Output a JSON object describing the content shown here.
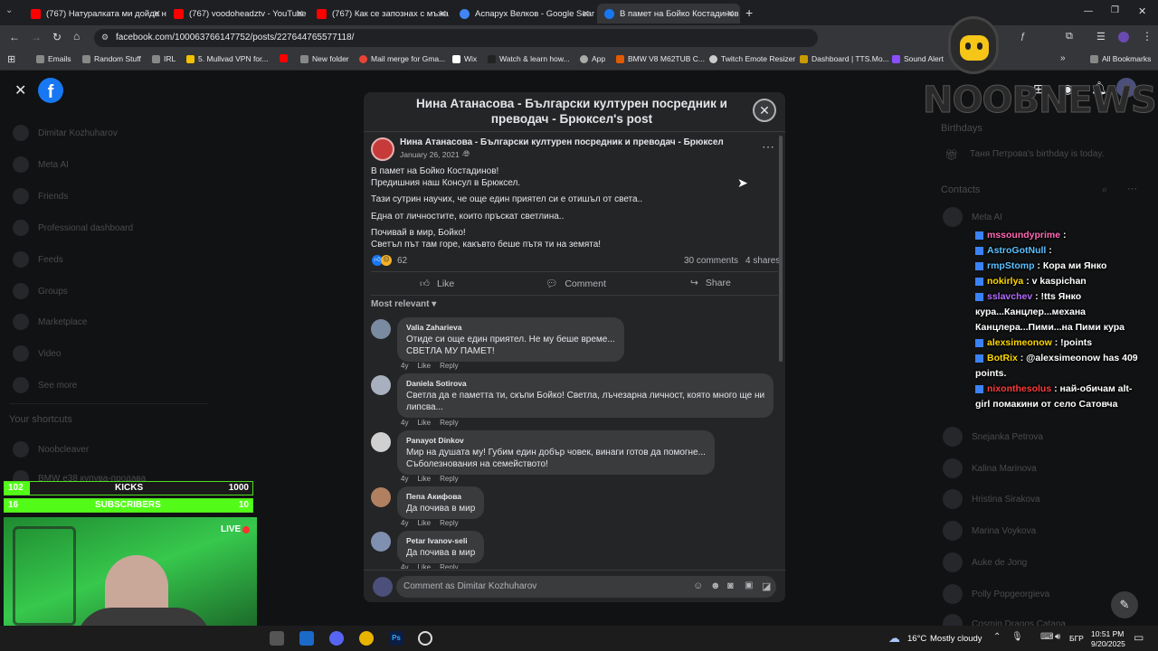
{
  "browser": {
    "tabs": [
      {
        "title": "(767) Натуралката ми дойде н",
        "color": "#ff0000"
      },
      {
        "title": "(767) voodoheadztv - YouTube",
        "color": "#ff0000"
      },
      {
        "title": "(767) Как се запознах с мъжа",
        "color": "#ff0000"
      },
      {
        "title": "Аспарух Велков - Google Sear",
        "color": "#4285f4"
      },
      {
        "title": "В памет на Бойко Костадинов",
        "color": "#1877f2"
      }
    ],
    "url": "facebook.com/100063766147752/posts/227644765577118/",
    "bookmarks": [
      "Emails",
      "Random Stuff",
      "IRL",
      "5. Mullvad VPN for...",
      "New folder",
      "Mail merge for Gma...",
      "Wix",
      "Watch & learn how...",
      "App",
      "BMW V8 M62TUB C...",
      "Twitch Emote Resizer",
      "Dashboard | TTS.Mo...",
      "Sound Alert"
    ],
    "all_bookmarks": "All Bookmarks"
  },
  "sidebar": {
    "user": "Dimitar Kozhuharov",
    "items": [
      "Meta AI",
      "Friends",
      "Professional dashboard",
      "Feeds",
      "Groups",
      "Marketplace",
      "Video",
      "See more"
    ],
    "shortcuts_title": "Your shortcuts",
    "shortcuts": [
      "Noobcleaver",
      "BMW e38 купува-продава"
    ]
  },
  "right_panel": {
    "birthdays_title": "Birthdays",
    "birthday_text": "Таня Петрова's birthday is today.",
    "contacts_title": "Contacts",
    "contacts": [
      "Meta AI",
      "Snejanka Petrova",
      "Kalina Marinova",
      "Hristina Sirakova",
      "Marina Voykova",
      "Auke de Jong",
      "Polly Popgeorgieva",
      "Cosmin Dragos Catana"
    ]
  },
  "modal": {
    "title": "Нина Атанасова - Български културен посредник и преводач - Брюксел's post",
    "author": "Нина Атанасова - Български културен посредник и преводач - Брюксел",
    "date": "January 26, 2021 · ",
    "text_lines": [
      "В памет на Бойко Костадинов!",
      "Предишния наш Консул в Брюксел.",
      "Тази сутрин научих, че още един приятел си е отишъл от света..",
      "Една от личностите, които пръскат светлина..",
      "Почивай в мир, Бойко!",
      "Светъл път там горе, какъвто беше пътя ти на земята!"
    ],
    "reactions_count": "62",
    "comments_count": "30 comments",
    "shares_count": "4 shares",
    "actions": {
      "like": "Like",
      "comment": "Comment",
      "share": "Share"
    },
    "sort_label": "Most relevant",
    "comments": [
      {
        "name": "Valia Zaharieva",
        "lines": [
          "Отиде си още един приятел. Не му беше време...",
          "СВЕТЛА МУ ПАМЕТ!"
        ],
        "age": "4y"
      },
      {
        "name": "Daniela Sotirova",
        "lines": [
          "Светла да е паметта ти, скъпи Бойко! Светла, лъчезарна личност, която много ще ни",
          "липсва..."
        ],
        "age": "4y"
      },
      {
        "name": "Panayot Dinkov",
        "lines": [
          "Мир на душата му! Губим един добър човек, винаги готов да помогне...",
          "Съболезнования на семейството!"
        ],
        "age": "4y"
      },
      {
        "name": "Пепа Акифова",
        "lines": [
          "Да почива в мир"
        ],
        "age": "4y"
      },
      {
        "name": "Petar Ivanov-seli",
        "lines": [
          "Да почива в мир"
        ],
        "age": "4y"
      }
    ],
    "like_label": "Like",
    "reply_label": "Reply",
    "comment_placeholder": "Comment as Dimitar Kozhuharov"
  },
  "stream_overlay": {
    "kicks": {
      "current": "102",
      "label": "KICKS",
      "goal": "1000",
      "progress": 0.102
    },
    "subs": {
      "current": "16",
      "label": "SUBSCRIBERS",
      "goal": "10",
      "progress": 1.0
    },
    "live_label": "LIVE",
    "logo_text": "NOOBNEWS",
    "chat": [
      {
        "user": "mssoundyprime",
        "text": " : ",
        "color": "#ff69b4"
      },
      {
        "user": "AstroGotNull",
        "text": " : ",
        "color": "#5bc0ff"
      },
      {
        "user": "rmpStomp",
        "text": " : Кора ми Янко",
        "color": "#5bc0ff"
      },
      {
        "user": "nokirlya",
        "text": " : v kaspichan",
        "color": "#ffd700"
      },
      {
        "user": "sslavchev",
        "text": " : !tts Янко кура...Канцлер...механа Канцлера...Пими...на Пими кура",
        "color": "#b36bff"
      },
      {
        "user": "alexsimeonow",
        "text": " : !points",
        "color": "#ffd700"
      },
      {
        "user": "BotRix",
        "text": " : @alexsimeonow has 409 points.",
        "color": "#ffd700"
      },
      {
        "user": "nixonthesolus",
        "text": " : най-обичам alt-girl помакини от село Сатовча",
        "color": "#ff3b3b"
      }
    ]
  },
  "taskbar": {
    "weather": "16°C",
    "weather_text": "Mostly cloudy",
    "lang": "БГР",
    "time": "10:51 PM",
    "date": "9/20/2025"
  }
}
